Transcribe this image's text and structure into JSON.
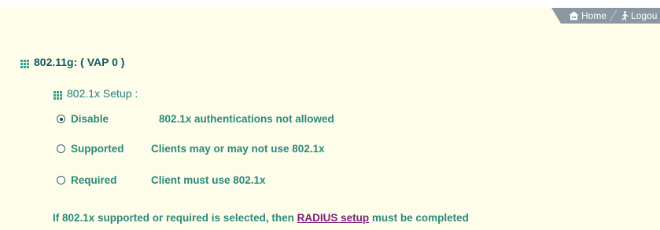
{
  "topnav": {
    "home_label": "Home",
    "logout_label": "Logou"
  },
  "section": {
    "title": "802.11g: ( VAP 0 )",
    "subtitle": "802.1x Setup :"
  },
  "options": [
    {
      "label": "Disable",
      "description": "802.1x authentications not allowed",
      "checked": true
    },
    {
      "label": "Supported",
      "description": "Clients may or may not use 802.1x",
      "checked": false
    },
    {
      "label": "Required",
      "description": "Client must use 802.1x",
      "checked": false
    }
  ],
  "note": {
    "before": "If 802.1x supported or required is selected, then ",
    "link": "RADIUS setup",
    "after": " must be completed"
  },
  "colors": {
    "background": "#fefde9",
    "title": "#0f5a63",
    "text": "#2a8a7c",
    "link": "#7a1f7f",
    "nav_tab": "#8a98a4"
  }
}
